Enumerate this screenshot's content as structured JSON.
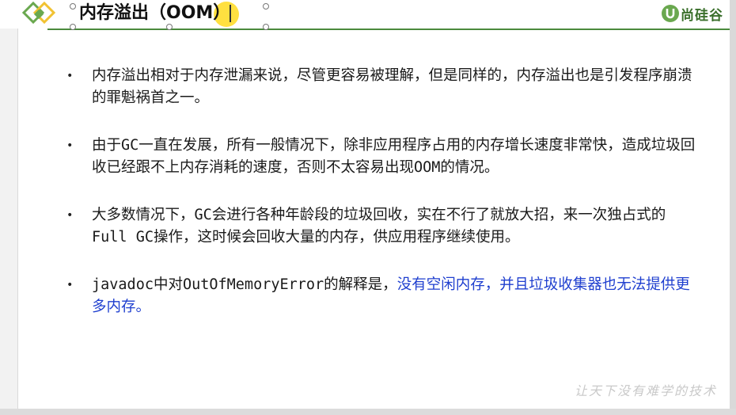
{
  "slide": {
    "title": "内存溢出（OOM）",
    "brand_text": "尚硅谷",
    "watermark": "让天下没有难学的技术"
  },
  "bullets": [
    {
      "text": "内存溢出相对于内存泄漏来说，尽管更容易被理解，但是同样的，内存溢出也是引发程序崩溃的罪魁祸首之一。"
    },
    {
      "text": "由于GC一直在发展，所有一般情况下，除非应用程序占用的内存增长速度非常快，造成垃圾回收已经跟不上内存消耗的速度，否则不太容易出现OOM的情况。"
    },
    {
      "text": "大多数情况下，GC会进行各种年龄段的垃圾回收，实在不行了就放大招，来一次独占式的Full GC操作，这时候会回收大量的内存，供应用程序继续使用。"
    },
    {
      "text": "javadoc中对OutOfMemoryError的解释是，",
      "highlight": "没有空闲内存，并且垃圾收集器也无法提供更多内存。"
    }
  ],
  "colors": {
    "accent_green": "#4a8a3c",
    "link_blue": "#1f3fcf",
    "cursor_highlight": "#ffd600"
  }
}
